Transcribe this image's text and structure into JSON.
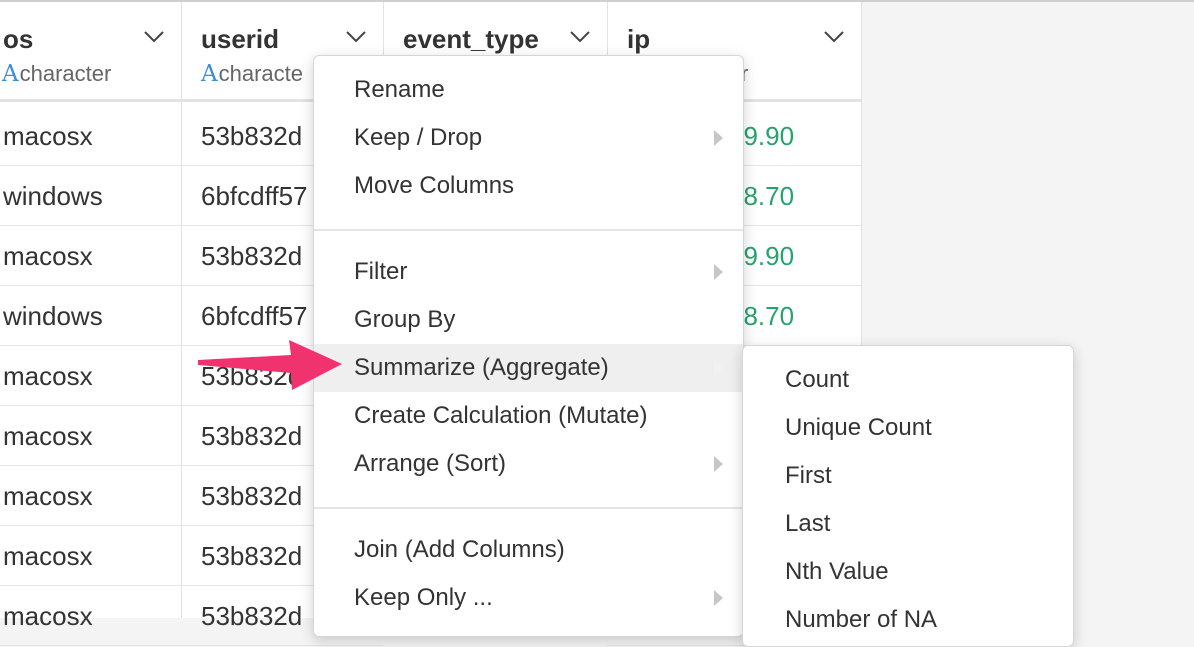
{
  "columns": [
    {
      "name": "os",
      "type": "character",
      "values": [
        "macosx",
        "windows",
        "macosx",
        "windows",
        "macosx",
        "macosx",
        "macosx",
        "macosx",
        "macosx"
      ]
    },
    {
      "name": "userid",
      "type": "characte",
      "values": [
        "53b832d",
        "6bfcdff57",
        "53b832d",
        "6bfcdff57",
        "53b832d",
        "53b832d",
        "53b832d",
        "53b832d",
        "53b832d"
      ]
    },
    {
      "name": "event_type"
    },
    {
      "name": "ip",
      "type_fragment": "r",
      "values": [
        "39.90",
        "48.70",
        "39.90",
        "48.70"
      ]
    }
  ],
  "type_icon": "A",
  "context_menu": {
    "items": [
      "Rename",
      "Keep / Drop",
      "Move Columns",
      "Filter",
      "Group By",
      "Summarize (Aggregate)",
      "Create Calculation (Mutate)",
      "Arrange (Sort)",
      "Join (Add Columns)",
      "Keep Only ..."
    ]
  },
  "submenu": {
    "items": [
      "Count",
      "Unique Count",
      "First",
      "Last",
      "Nth Value",
      "Number of NA"
    ]
  },
  "colors": {
    "accent_arrow": "#f0326e",
    "ip_value": "#27a36d",
    "type_icon": "#3c8fd6"
  }
}
